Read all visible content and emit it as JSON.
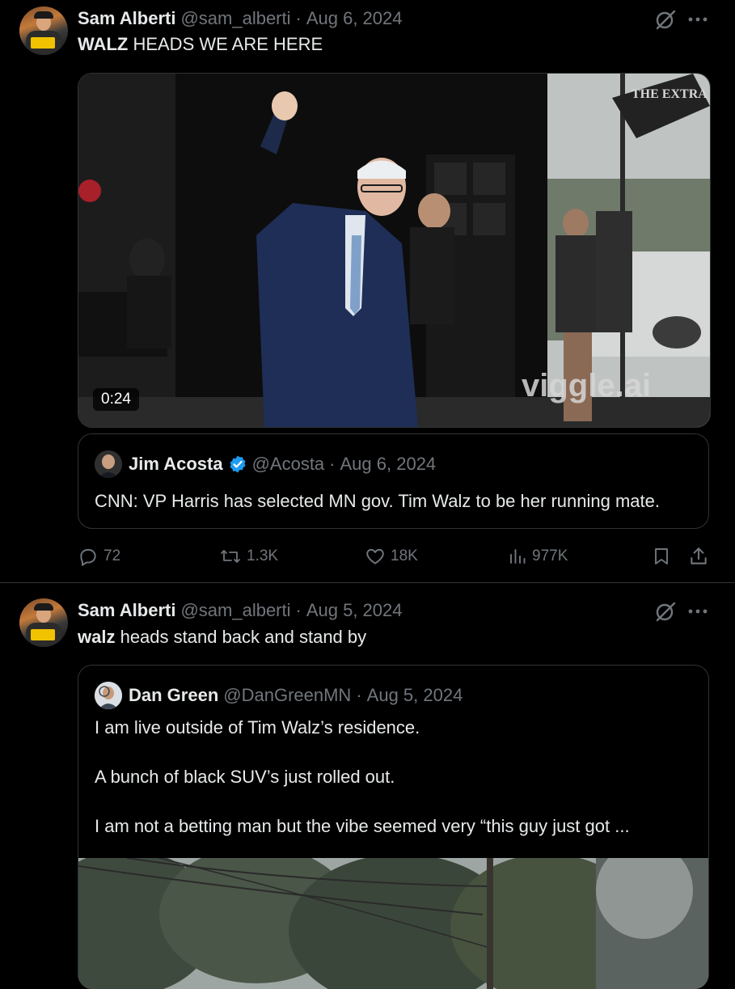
{
  "tweets": [
    {
      "author_name": "Sam Alberti",
      "author_handle": "@sam_alberti",
      "separator": "·",
      "date": "Aug 6, 2024",
      "text_bold": "WALZ",
      "text_rest": " HEADS WE ARE HERE",
      "video": {
        "duration": "0:24",
        "watermark_top": "THE EXTRA",
        "watermark_bottom": "viggle.ai"
      },
      "quote": {
        "author_name": "Jim Acosta",
        "author_handle": "@Acosta",
        "separator": "·",
        "date": "Aug 6, 2024",
        "text": "CNN: VP Harris has selected MN gov. Tim Walz to be her running mate."
      },
      "stats": {
        "replies": "72",
        "reposts": "1.3K",
        "likes": "18K",
        "views": "977K"
      }
    },
    {
      "author_name": "Sam Alberti",
      "author_handle": "@sam_alberti",
      "separator": "·",
      "date": "Aug 5, 2024",
      "text_bold": "walz",
      "text_rest": " heads stand back and stand by",
      "quote": {
        "author_name": "Dan Green",
        "author_handle": "@DanGreenMN",
        "separator": "·",
        "date": "Aug 5, 2024",
        "lines": [
          "I am live outside of Tim Walz’s residence.",
          "A bunch of black SUV’s just rolled out.",
          "I am not a betting man but the vibe seemed very “this guy just got ..."
        ]
      }
    }
  ],
  "icons": {
    "grok": "grok-icon",
    "more": "more-icon",
    "reply": "reply-icon",
    "repost": "repost-icon",
    "like": "heart-icon",
    "views": "views-icon",
    "bookmark": "bookmark-icon",
    "share": "share-icon",
    "verified": "verified-badge-icon"
  },
  "colors": {
    "background": "#000000",
    "text": "#e7e9ea",
    "muted": "#71767b",
    "border": "#2f3336",
    "verified": "#1d9bf0"
  }
}
